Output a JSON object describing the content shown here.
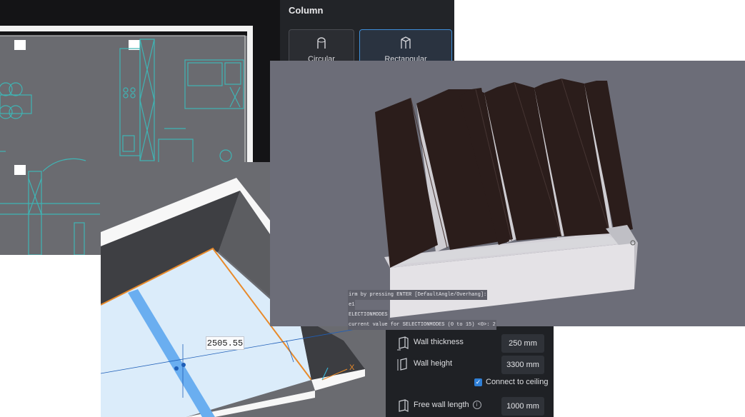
{
  "column_panel": {
    "title": "Column",
    "options": [
      {
        "label": "Circular",
        "selected": false
      },
      {
        "label": "Rectangular",
        "selected": true
      }
    ]
  },
  "dimension": {
    "value": "2505.55"
  },
  "wall_properties": {
    "thickness": {
      "label": "Wall thickness",
      "value": "250 mm"
    },
    "height": {
      "label": "Wall height",
      "value": "3300 mm"
    },
    "connect_to_ceiling": {
      "label": "Connect to ceiling",
      "checked": true
    },
    "free_wall_length": {
      "label": "Free wall length",
      "value": "1000 mm"
    }
  },
  "console": {
    "lines": [
      "irm by pressing ENTER [DefaultAngle/Overhang]:",
      "e1",
      "ELECTIONMODES",
      "current value for SELECTIONMODES (0 to 15) <0>: 2"
    ]
  },
  "axis_label": "X",
  "colors": {
    "accent_blue": "#3e8ed8",
    "plan_lines": "#3fb5b5",
    "roof_dark": "#2a1c1a"
  }
}
